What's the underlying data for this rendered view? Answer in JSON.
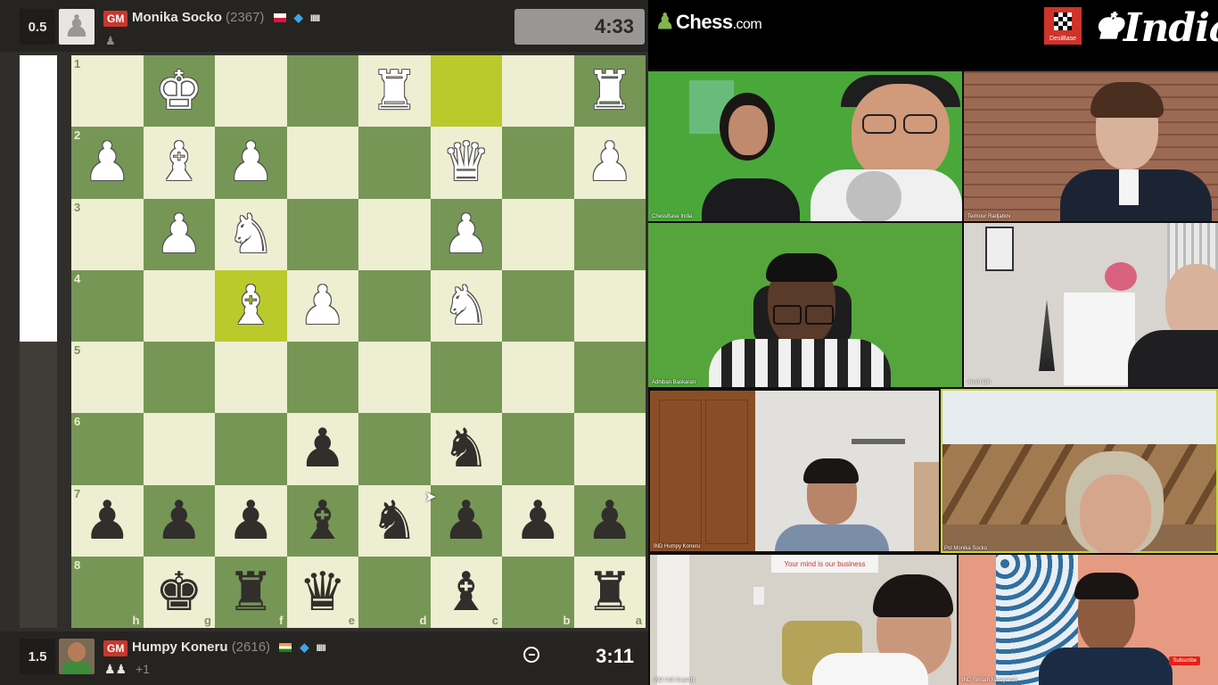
{
  "top_player": {
    "score": "0.5",
    "title": "GM",
    "name": "Monika Socko",
    "rating": "(2367)",
    "clock": "4:33",
    "bars": "IIIII"
  },
  "bottom_player": {
    "score": "1.5",
    "title": "GM",
    "name": "Humpy Koneru",
    "rating": "(2616)",
    "clock": "3:11",
    "extra": "+1",
    "bars": "IIIII"
  },
  "eval": {
    "white_fraction": 0.5
  },
  "board": {
    "ranks": [
      "1",
      "2",
      "3",
      "4",
      "5",
      "6",
      "7",
      "8"
    ],
    "files": [
      "h",
      "g",
      "f",
      "e",
      "d",
      "c",
      "b",
      "a"
    ],
    "rows": [
      [
        "",
        "wK",
        "",
        "",
        "wR",
        "",
        "",
        "wR"
      ],
      [
        "wP",
        "wB",
        "wP",
        "",
        "",
        "wQ",
        "",
        "wP"
      ],
      [
        "",
        "wP",
        "wN",
        "",
        "",
        "wP",
        "",
        ""
      ],
      [
        "",
        "",
        "wB",
        "wP",
        "",
        "wN",
        "",
        ""
      ],
      [
        "",
        "",
        "",
        "",
        "",
        "",
        "",
        ""
      ],
      [
        "",
        "",
        "",
        "bP",
        "",
        "bN",
        "",
        ""
      ],
      [
        "bP",
        "bP",
        "bP",
        "bB",
        "bN",
        "bP",
        "bP",
        "bP"
      ],
      [
        "",
        "bK",
        "bR",
        "bQ",
        "",
        "bB",
        "",
        "bR"
      ]
    ],
    "highlights": [
      "0-5",
      "3-2"
    ]
  },
  "header": {
    "brand": "Chess",
    "brand_suffix": ".com",
    "partner": "DesiBase",
    "partner_logo_text": "India"
  },
  "participants": [
    {
      "name": "ChessBase India"
    },
    {
      "name": "Teimour Radjabov"
    },
    {
      "name": "Adhiban Baskaran"
    },
    {
      "name": "Anish Giri"
    },
    {
      "name": "IND Humpy Koneru"
    },
    {
      "name": "Pol Monika Socko"
    },
    {
      "name": "IND Vidit Gujrathi"
    },
    {
      "name": "IND Srinath Narayanan"
    }
  ],
  "wall_sign": "Your mind is our business",
  "subscribe_label": "Subscribe",
  "colors": {
    "board_light": "#eeeed2",
    "board_dark": "#769656",
    "gm_badge": "#c8372d",
    "brand_green": "#81b64c"
  }
}
